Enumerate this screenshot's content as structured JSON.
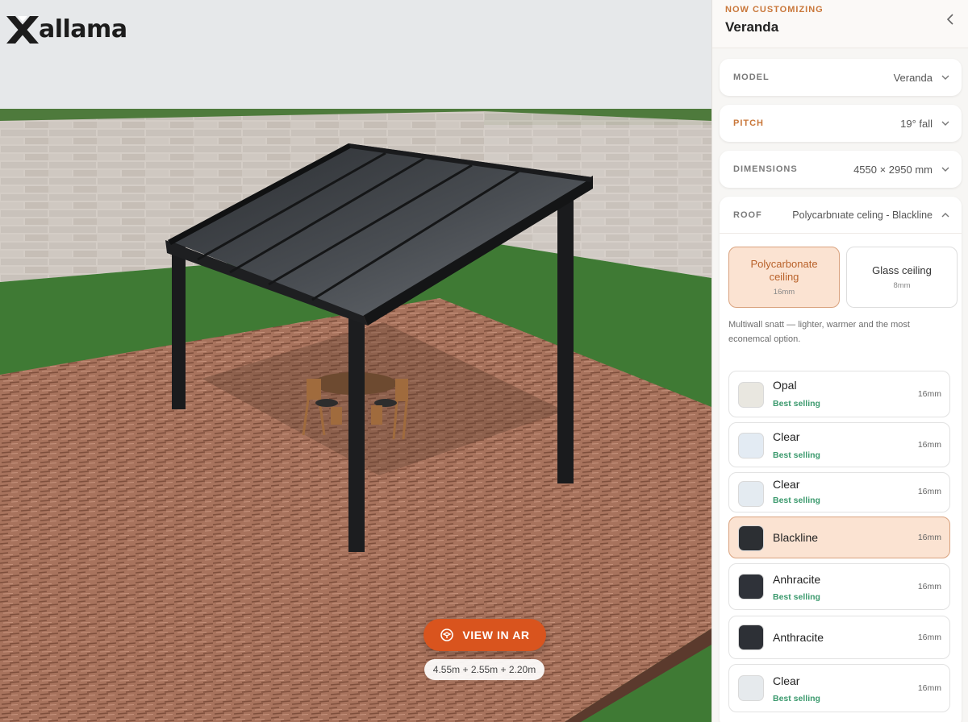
{
  "app": {
    "logo_text": "allama"
  },
  "scene": {
    "ar_button_label": "VIEW IN AR",
    "dimensions_label": "4.55m + 2.55m + 2.20m"
  },
  "sidebar": {
    "eyebrow": "NOW CUSTOMIZING",
    "title": "Veranda",
    "sections": {
      "model": {
        "label": "MODEL",
        "value": "Veranda"
      },
      "pitch": {
        "label": "PITCH",
        "value": "19° fall"
      },
      "dimensions": {
        "label": "DIMENSIONS",
        "value": "4550 × 2950 mm"
      },
      "roof": {
        "label": "ROOF",
        "value": "Polycarbnıate celing - Blackline"
      }
    },
    "roof_types": [
      {
        "title": "Polycarbonate ceiling",
        "sub": "16mm",
        "selected": true
      },
      {
        "title": "Glass ceiling",
        "sub": "8mm",
        "selected": false
      }
    ],
    "description": "Multiwall snatt — lighter, warmer and the most econemcal option.",
    "options": [
      {
        "name": "Opal",
        "badge": "Best selling",
        "size": "16mm",
        "color": "#e9e7e0",
        "selected": false
      },
      {
        "name": "Clear",
        "badge": "Best selling",
        "size": "16mm",
        "color": "#e3ebf3",
        "selected": false
      },
      {
        "name": "Clear",
        "badge": "Best selling",
        "size": "16mm",
        "color": "#e4ebf1",
        "selected": false
      },
      {
        "name": "Blackline",
        "badge": "",
        "size": "16mm",
        "color": "#2c2f33",
        "selected": true
      },
      {
        "name": "Anhracite",
        "badge": "Best selling",
        "size": "16mm",
        "color": "#2f3239",
        "selected": false
      },
      {
        "name": "Anthracite",
        "badge": "",
        "size": "16mm",
        "color": "#2d3036",
        "selected": false
      },
      {
        "name": "Clear",
        "badge": "Best selling",
        "size": "16mm",
        "color": "#e6eaed",
        "selected": false
      }
    ],
    "accent_color": "#d9541e",
    "best_selling_color": "#3c9a6e"
  }
}
